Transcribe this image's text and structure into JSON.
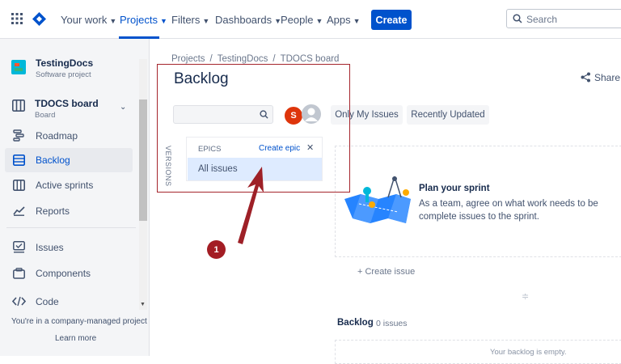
{
  "topnav": {
    "items": [
      {
        "label": "Your work"
      },
      {
        "label": "Projects"
      },
      {
        "label": "Filters"
      },
      {
        "label": "Dashboards"
      },
      {
        "label": "People"
      },
      {
        "label": "Apps"
      }
    ],
    "create_label": "Create",
    "search_placeholder": "Search"
  },
  "sidebar": {
    "project_name": "TestingDocs",
    "project_type": "Software project",
    "board_name": "TDOCS board",
    "board_sub": "Board",
    "items": [
      {
        "label": "Roadmap",
        "icon": "roadmap-icon"
      },
      {
        "label": "Backlog",
        "icon": "backlog-icon"
      },
      {
        "label": "Active sprints",
        "icon": "columns-icon"
      },
      {
        "label": "Reports",
        "icon": "chart-icon"
      },
      {
        "label": "Issues",
        "icon": "issues-icon"
      },
      {
        "label": "Components",
        "icon": "components-icon"
      },
      {
        "label": "Code",
        "icon": "code-icon"
      }
    ],
    "footer_text": "You're in a company-managed project",
    "learn_more": "Learn more"
  },
  "breadcrumb": [
    "Projects",
    "TestingDocs",
    "TDOCS board"
  ],
  "page_title": "Backlog",
  "share_label": "Share",
  "avatar_initial": "S",
  "filters": [
    "Only My Issues",
    "Recently Updated"
  ],
  "versions_label": "VERSIONS",
  "epics": {
    "header": "EPICS",
    "create_label": "Create epic",
    "close_glyph": "✕",
    "all_issues": "All issues"
  },
  "sprint": {
    "title": "Plan your sprint",
    "description": "As a team, agree on what work needs to be complete issues to the sprint."
  },
  "create_issue": "+ Create issue",
  "backlog": {
    "title": "Backlog",
    "count": "0 issues",
    "empty": "Your backlog is empty."
  },
  "annotation": {
    "badge": "1"
  },
  "colors": {
    "accent": "#0052cc",
    "annotation": "#a31d24"
  }
}
